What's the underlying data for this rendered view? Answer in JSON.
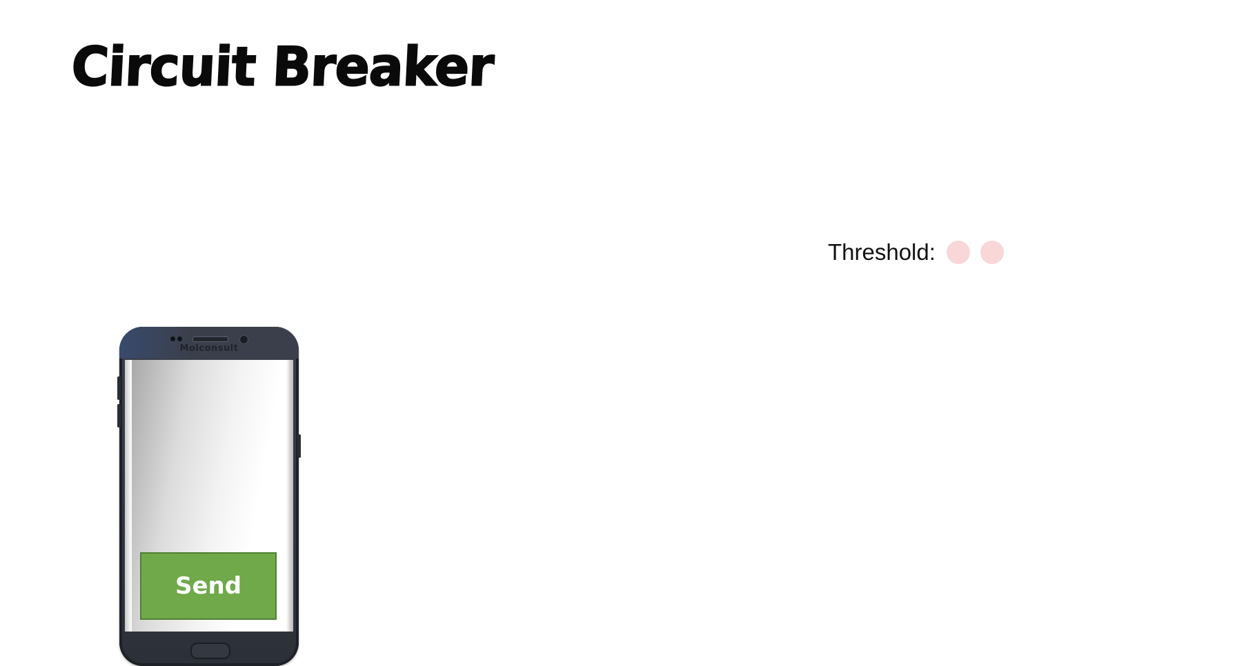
{
  "app": {
    "title": "Circuit Breaker"
  },
  "threshold": {
    "label": "Threshold:",
    "indicator_count": 2,
    "indicator_color": "#f9d6d8"
  },
  "phone": {
    "brand": "Moiconsult",
    "send_label": "Send",
    "send_color": "#6fa94a"
  }
}
